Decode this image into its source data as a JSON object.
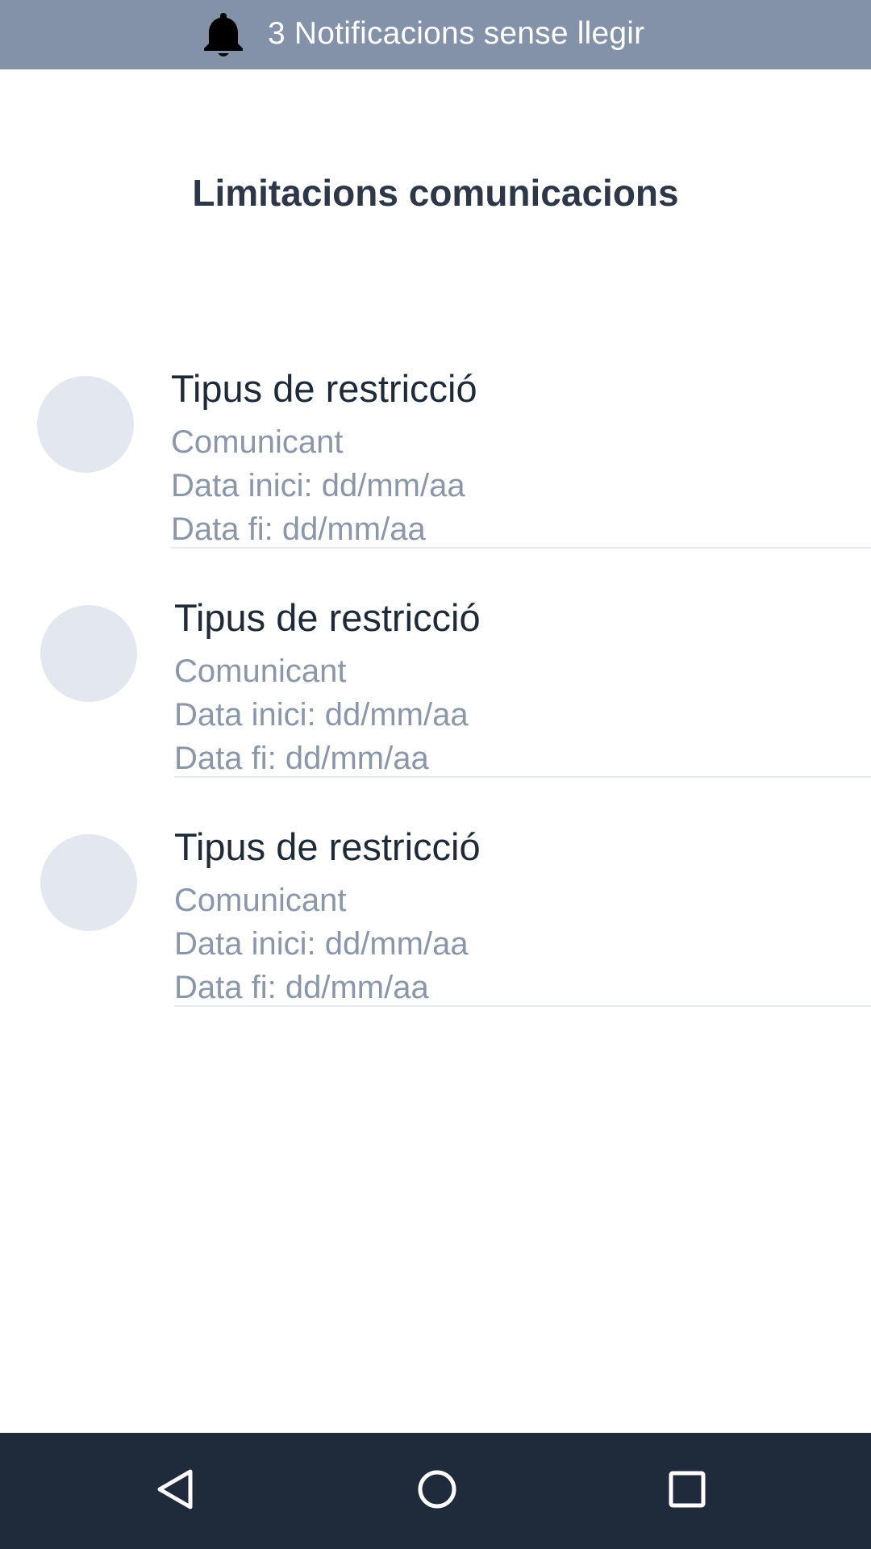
{
  "notification_bar": {
    "icon": "bell-icon",
    "text": "3 Notificacions sense llegir"
  },
  "page": {
    "title": "Limitacions comunicacions"
  },
  "items": [
    {
      "title": "Tipus de restricció",
      "subtitle": "Comunicant",
      "start": "Data inici: dd/mm/aa",
      "end": "Data fi: dd/mm/aa"
    },
    {
      "title": "Tipus de restricció",
      "subtitle": "Comunicant",
      "start": "Data inici: dd/mm/aa",
      "end": "Data fi: dd/mm/aa"
    },
    {
      "title": "Tipus de restricció",
      "subtitle": "Comunicant",
      "start": "Data inici: dd/mm/aa",
      "end": "Data fi: dd/mm/aa"
    }
  ],
  "nav_bar": {
    "back_icon": "back-triangle-icon",
    "home_icon": "home-circle-icon",
    "recent_icon": "recent-apps-square-icon"
  },
  "colors": {
    "notification_bar": "#8392a8",
    "nav_bar": "#1f2a3b",
    "avatar_placeholder": "#e3e8f0",
    "title_text": "#2d3748",
    "secondary_text": "#8a97aa"
  }
}
